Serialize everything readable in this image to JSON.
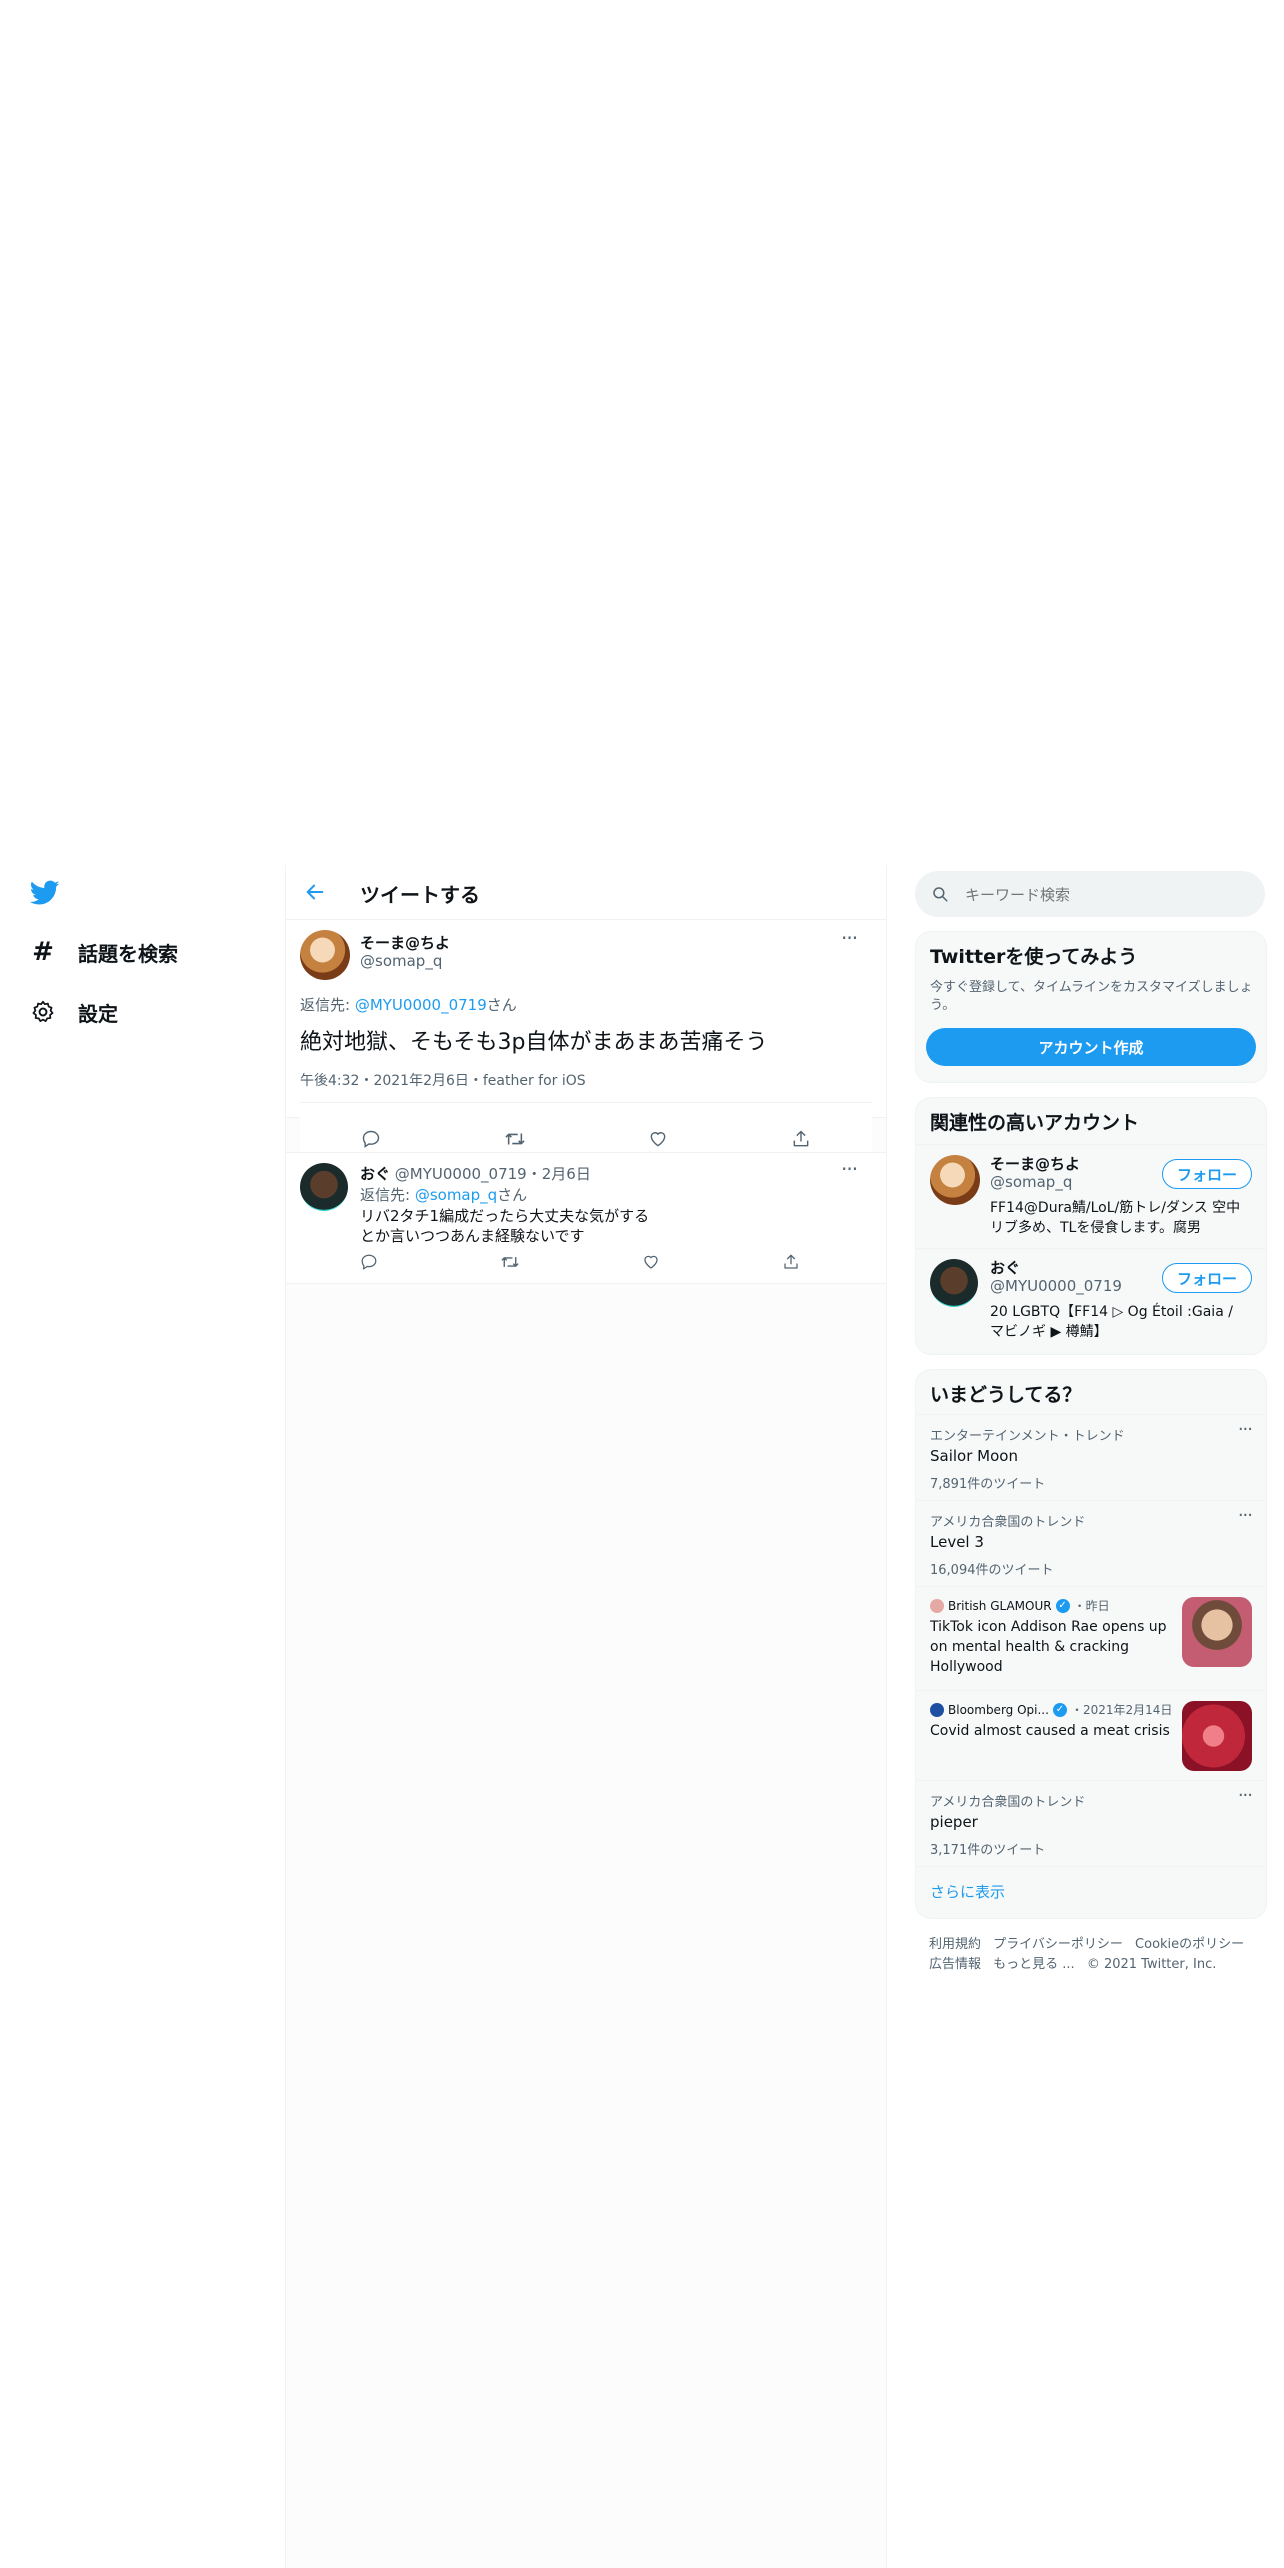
{
  "nav": {
    "items": [
      {
        "label": "話題を検索",
        "icon": "hashtag-icon"
      },
      {
        "label": "設定",
        "icon": "gear-icon"
      }
    ]
  },
  "header": {
    "title": "ツイートする"
  },
  "main_tweet": {
    "display_name": "そーま@ちよ",
    "handle": "@somap_q",
    "reply_prefix": "返信先: ",
    "reply_to": "@MYU0000_0719",
    "reply_suffix": "さん",
    "text": "絶対地獄、そもそも3p自体がまあまあ苦痛そう",
    "meta": "午後4:32・2021年2月6日・feather for iOS"
  },
  "reply_tweet": {
    "display_name": "おぐ",
    "handle": "@MYU0000_0719",
    "date": "・2月6日",
    "reply_prefix": "返信先: ",
    "reply_to": "@somap_q",
    "reply_suffix": "さん",
    "text_line1": "リバ2タチ1編成だったら大丈夫な気がする",
    "text_line2": "とか言いつつあんま経験ないです"
  },
  "search": {
    "placeholder": "キーワード検索"
  },
  "signup": {
    "title": "Twitterを使ってみよう",
    "desc_line1": "今すぐ登録して、タイムラインをカスタマイズしましょ",
    "desc_line2": "う。",
    "button": "アカウント作成"
  },
  "related": {
    "title": "関連性の高いアカウント",
    "follow_label": "フォロー",
    "accounts": [
      {
        "name": "そーま@ちよ",
        "handle": "@somap_q",
        "bio_line1": "FF14@Dura鯖/LoL/筋トレ/ダンス 空中",
        "bio_line2": "リブ多め、TLを侵食します。腐男"
      },
      {
        "name": "おぐ",
        "handle": "@MYU0000_0719",
        "bio_line1": "20 LGBTQ【FF14 ▷ Og Étoil :Gaia /",
        "bio_line2": "マビノギ ▶ 樽鯖】"
      }
    ]
  },
  "trends": {
    "title": "いまどうしてる？",
    "items": [
      {
        "category": "エンターテインメント・トレンド",
        "name": "Sailor Moon",
        "count": "7,891件のツイート"
      },
      {
        "category": "アメリカ合衆国のトレンド",
        "name": "Level 3",
        "count": "16,094件のツイート"
      },
      {
        "source": "British GLAMOUR",
        "time": "・昨日",
        "line1": "TikTok icon Addison Rae opens up",
        "line2": "on mental health & cracking",
        "line3": "Hollywood"
      },
      {
        "source": "Bloomberg Opi...",
        "time": "・2021年2月14日",
        "line1": "Covid almost caused a meat crisis"
      },
      {
        "category": "アメリカ合衆国のトレンド",
        "name": "pieper",
        "count": "3,171件のツイート"
      }
    ],
    "show_more": "さらに表示"
  },
  "footer": {
    "links_row1": [
      "利用規約",
      "プライバシーポリシー",
      "Cookieのポリシー"
    ],
    "links_row2": [
      "広告情報",
      "もっと見る ...",
      "© 2021 Twitter, Inc."
    ]
  },
  "colors": {
    "accent": "#1d9bf0",
    "text": "#0f1419",
    "muted": "#536471"
  }
}
